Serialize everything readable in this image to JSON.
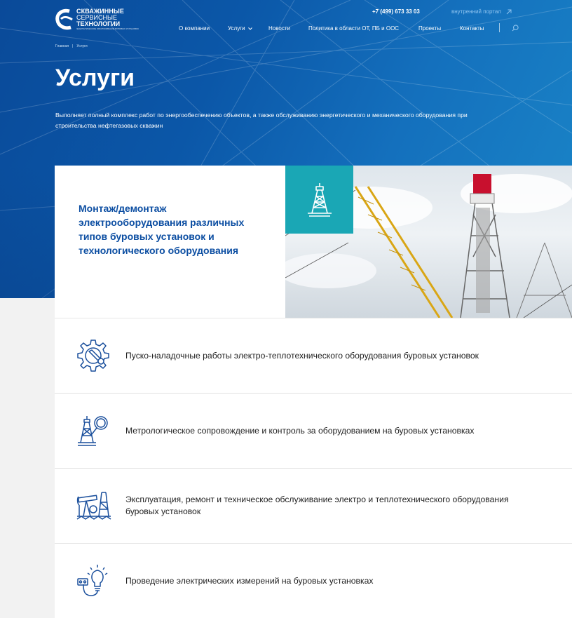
{
  "header": {
    "logo": {
      "line1": "СКВАЖИННЫЕ",
      "line2": "СЕРВИСНЫЕ",
      "line3": "ТЕХНОЛОГИИ",
      "line4": "ЭНЕРГЕТИЧЕСКОЕ ОБСЛУЖИВАНИЕ БУРОВЫХ УСТАНОВОК"
    },
    "phone": "+7 (499) 673 33 03",
    "portal_label": "внутренний портал",
    "nav": [
      {
        "label": "О компании"
      },
      {
        "label": "Услуги"
      },
      {
        "label": "Новости"
      },
      {
        "label": "Политика в области ОТ, ПБ и ООС"
      },
      {
        "label": "Проекты"
      },
      {
        "label": "Контакты"
      }
    ]
  },
  "breadcrumb": {
    "home": "Главная",
    "separator": "|",
    "current": "Услуги"
  },
  "page": {
    "title": "Услуги",
    "lead": "Выполняет полный комплекс работ по энергообеспечению объектов, а также обслуживанию энергетического и механического оборудования при строительства нефтегазовых скважин"
  },
  "feature": {
    "title": "Монтаж/демонтаж электрооборудования различных типов буровых установок и технологического оборудования",
    "icon": "drilling-rig-icon"
  },
  "services": [
    {
      "text": "Пуско-наладочные работы электро-теплотехнического оборудования буровых установок",
      "icon": "gear-wrench-icon"
    },
    {
      "text": "Метрологическое сопровождение и контроль за оборудованием на буровых установках",
      "icon": "rig-magnifier-icon"
    },
    {
      "text": "Эксплуатация, ремонт и техническое обслуживание электро и теплотехнического оборудования буровых установок",
      "icon": "pumpjack-icon"
    },
    {
      "text": "Проведение электрических измерений на буровых установках",
      "icon": "bulb-plug-icon"
    }
  ],
  "colors": {
    "brand_blue": "#0c4ea2",
    "accent_teal": "#1aa7b5",
    "icon_blue": "#1a4f9c",
    "portal_link": "#8fc4f0"
  }
}
